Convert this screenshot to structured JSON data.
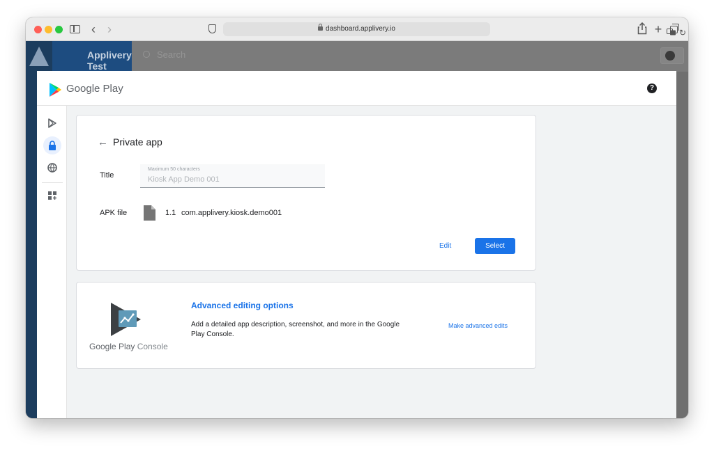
{
  "browser": {
    "url": "dashboard.applivery.io"
  },
  "background_app": {
    "brand": "Applivery Test",
    "search_placeholder": "Search"
  },
  "google_play": {
    "wordmark": "Google Play",
    "nav_items": [
      "play-icon",
      "lock-icon",
      "globe-icon",
      "apps-icon"
    ],
    "private_app": {
      "title": "Private app",
      "title_label": "Title",
      "title_hint": "Maximum 50 characters",
      "title_value": "Kiosk App Demo 001",
      "apk_label": "APK file",
      "apk_version": "1.1",
      "apk_package": "com.applivery.kiosk.demo001",
      "edit_label": "Edit",
      "select_label": "Select"
    },
    "advanced": {
      "logo_text_main": "Google Play",
      "logo_text_sub": "Console",
      "title": "Advanced editing options",
      "description": "Add a detailed app description, screenshot, and more in the Google Play Console.",
      "action_label": "Make advanced edits"
    }
  },
  "colors": {
    "accent": "#1a73e8",
    "nav_active_bg": "#e8f0fe"
  }
}
